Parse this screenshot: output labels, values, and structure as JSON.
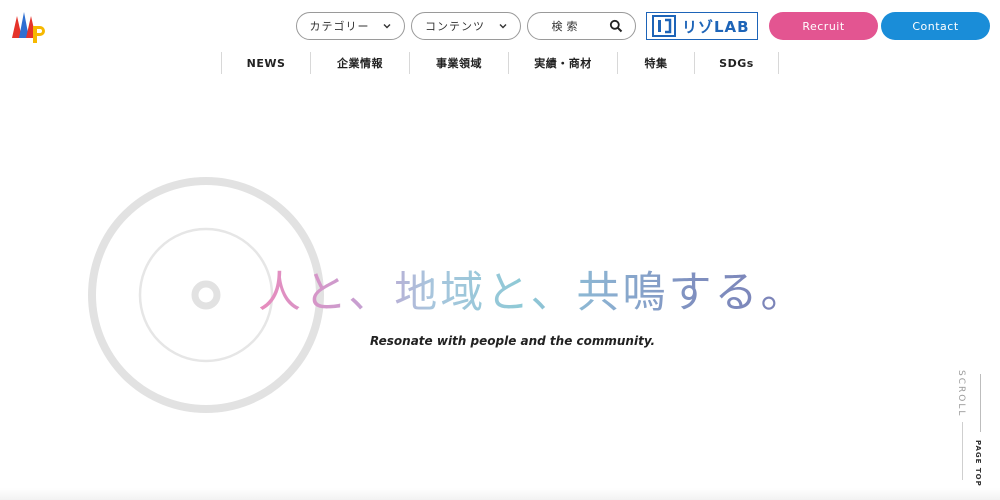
{
  "header": {
    "logo_icon": "mmp-logo-icon",
    "dropdowns": [
      {
        "label": "カテゴリー",
        "icon": "chevron-down-icon"
      },
      {
        "label": "コンテンツ",
        "icon": "chevron-down-icon"
      }
    ],
    "search": {
      "label": "検索",
      "icon": "search-icon"
    },
    "lab_logo": {
      "text": "リゾLAB",
      "icon": "lab-mark-icon",
      "color": "#1d64b8"
    },
    "recruit_label": "Recruit",
    "contact_label": "Contact",
    "colors": {
      "recruit": "#e35591",
      "contact": "#1a8dd8"
    }
  },
  "nav": {
    "items": [
      {
        "label": "NEWS"
      },
      {
        "label": "企業情報"
      },
      {
        "label": "事業領域"
      },
      {
        "label": "実績・商材"
      },
      {
        "label": "特集"
      },
      {
        "label": "SDGs"
      }
    ]
  },
  "hero": {
    "catch": "人と、地域と、共鳴する。",
    "sub": "Resonate with people and the community.",
    "gradient": [
      "#e88bbd",
      "#8ec9d6",
      "#7a7fb6"
    ]
  },
  "side": {
    "scroll_label": "SCROLL",
    "pagetop_label": "PAGE TOP"
  }
}
